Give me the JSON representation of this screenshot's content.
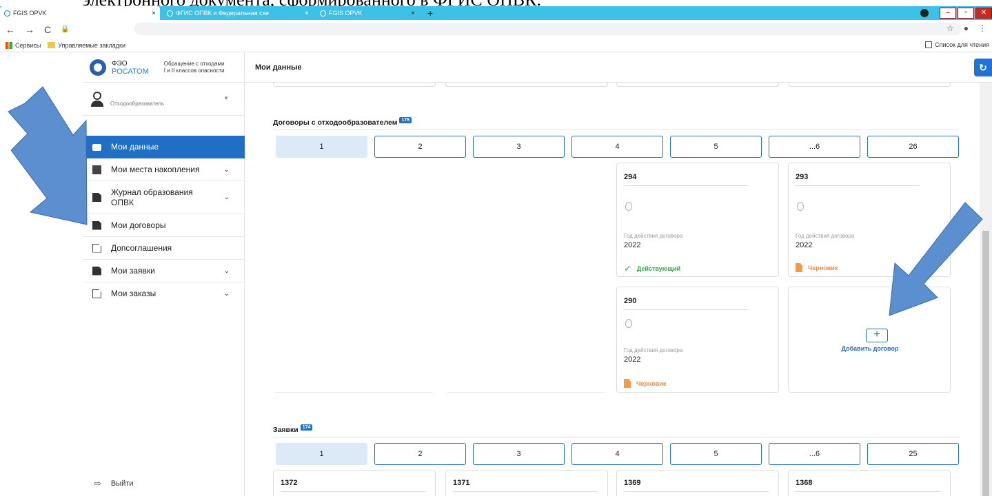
{
  "doc_fragment": "электронного документа, сформированного в ФГИС ОПВК.",
  "browser": {
    "tabs": [
      {
        "title": "FGIS OPVK",
        "active": true
      },
      {
        "title": "ФГИС ОПВК и Федеральная схе",
        "active": false
      },
      {
        "title": "FGIS OPVK",
        "active": false
      }
    ],
    "close_glyph": "×",
    "newtab_glyph": "+",
    "window_controls": [
      "–",
      "▫",
      "✕"
    ],
    "bookmarks": [
      "Сервисы",
      "Управляемые закладки"
    ],
    "reading_list": "Список для чтения"
  },
  "app": {
    "logo_title": "ФЭО",
    "logo_brand": "РОСАТОМ",
    "logo_sub_line1": "Обращение с отходами",
    "logo_sub_line2": "I и II классов опасности",
    "user_role": "Отходообразователь",
    "menu": [
      {
        "label": "Мои данные",
        "icon": "folder-icon",
        "active": true,
        "chevron": false
      },
      {
        "label": "Мои места накопления",
        "icon": "trash-icon",
        "active": false,
        "chevron": true
      },
      {
        "label": "Журнал образования ОПВК",
        "icon": "document-icon",
        "active": false,
        "chevron": true
      },
      {
        "label": "Мои договоры",
        "icon": "document-icon",
        "active": false,
        "chevron": false
      },
      {
        "label": "Допсоглашения",
        "icon": "document-outline-icon",
        "active": false,
        "chevron": false
      },
      {
        "label": "Мои заявки",
        "icon": "document-icon",
        "active": false,
        "chevron": true
      },
      {
        "label": "Мои заказы",
        "icon": "document-outline-icon",
        "active": false,
        "chevron": true
      }
    ],
    "logout": "Выйти",
    "header_title": "Мои данные"
  },
  "contracts": {
    "title": "Договоры с отходообразователем",
    "count": "178",
    "pages": [
      "1",
      "2",
      "3",
      "4",
      "5",
      "...6",
      "26"
    ],
    "current_page": "1",
    "year_label": "Год действия договора",
    "cards": [
      {
        "number": "294",
        "year": "2022",
        "status": "Действующий",
        "status_type": "ok"
      },
      {
        "number": "293",
        "year": "2022",
        "status": "Черновик",
        "status_type": "draft"
      },
      {
        "number": "290",
        "year": "2022",
        "status": "Черновик",
        "status_type": "draft"
      }
    ],
    "add_label": "Добавить договор"
  },
  "requests": {
    "title": "Заявки",
    "count": "174",
    "pages": [
      "1",
      "2",
      "3",
      "4",
      "5",
      "...6",
      "25"
    ],
    "current_page": "1",
    "cards": [
      "1372",
      "1371",
      "1369",
      "1368"
    ]
  },
  "colors": {
    "accent": "#1f6fc5",
    "status_ok": "#3aa24a",
    "status_draft": "#f08a3a",
    "tabbar": "#3cc2e6",
    "arrow": "#5b8fd0"
  }
}
